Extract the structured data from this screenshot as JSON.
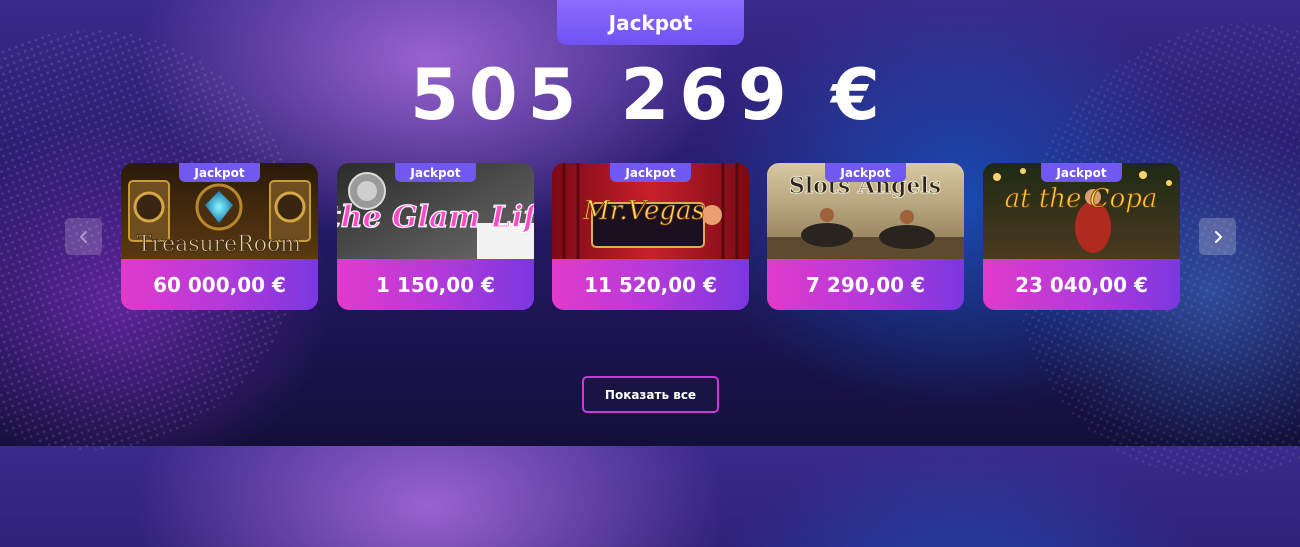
{
  "header": {
    "tab_label": "Jackpot",
    "total_amount": "505 269 €"
  },
  "carousel": {
    "prev_icon": "chevron-left-icon",
    "next_icon": "chevron-right-icon",
    "cards": [
      {
        "badge": "Jackpot",
        "thumb_title": "TreasureRoom",
        "amount": "60 000,00 €"
      },
      {
        "badge": "Jackpot",
        "thumb_title": "the Glam Life",
        "amount": "1 150,00 €"
      },
      {
        "badge": "Jackpot",
        "thumb_title": "Mr.Vegas",
        "amount": "11 520,00 €"
      },
      {
        "badge": "Jackpot",
        "thumb_title": "Slots Angels",
        "amount": "7 290,00 €"
      },
      {
        "badge": "Jackpot",
        "thumb_title": "at the Copa",
        "amount": "23 040,00 €"
      }
    ]
  },
  "footer": {
    "show_all_label": "Показать все"
  },
  "colors": {
    "tab": "#7b5cf5",
    "price_gradient_start": "#e13acb",
    "price_gradient_end": "#7a37e0",
    "button_border": "#c93ad7"
  }
}
